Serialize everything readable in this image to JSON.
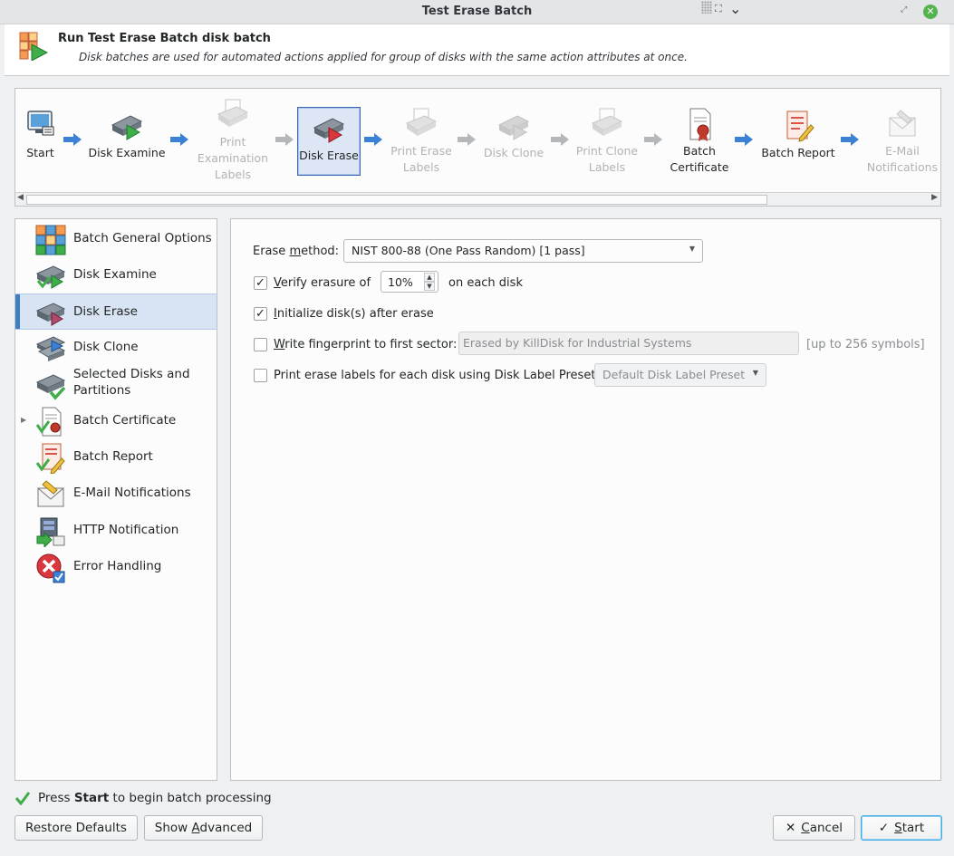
{
  "window": {
    "title": "Test Erase Batch"
  },
  "header": {
    "title": "Run Test Erase Batch disk batch",
    "subtitle": "Disk batches are used for automated actions applied for group of disks with the same action attributes at once."
  },
  "wizard_steps": [
    {
      "label": "Start",
      "icon": "computer-settings-icon",
      "state": "enabled"
    },
    {
      "label": "Disk Examine",
      "icon": "disk-play-icon",
      "state": "enabled"
    },
    {
      "label": "Print Examination Labels",
      "icon": "printer-icon",
      "state": "disabled"
    },
    {
      "label": "Disk Erase",
      "icon": "disk-erase-icon",
      "state": "current"
    },
    {
      "label": "Print Erase Labels",
      "icon": "printer-icon",
      "state": "disabled"
    },
    {
      "label": "Disk Clone",
      "icon": "disk-clone-icon",
      "state": "disabled"
    },
    {
      "label": "Print Clone Labels",
      "icon": "printer-icon",
      "state": "disabled"
    },
    {
      "label": "Batch Certificate",
      "icon": "certificate-icon",
      "state": "enabled"
    },
    {
      "label": "Batch Report",
      "icon": "report-icon",
      "state": "enabled"
    },
    {
      "label": "E-Mail Notifications",
      "icon": "email-icon",
      "state": "disabled"
    }
  ],
  "sidebar": {
    "items": [
      {
        "label": "Batch General Options",
        "icon": "grid-options-icon"
      },
      {
        "label": "Disk Examine",
        "icon": "disk-examine-icon"
      },
      {
        "label": "Disk Erase",
        "icon": "disk-erase-icon",
        "selected": true
      },
      {
        "label": "Disk Clone",
        "icon": "disk-clone-icon"
      },
      {
        "label": "Selected Disks and Partitions",
        "icon": "disk-check-icon"
      },
      {
        "label": "Batch Certificate",
        "icon": "certificate-icon"
      },
      {
        "label": "Batch Report",
        "icon": "report-icon"
      },
      {
        "label": "E-Mail Notifications",
        "icon": "email-icon"
      },
      {
        "label": "HTTP Notification",
        "icon": "http-icon"
      },
      {
        "label": "Error Handling",
        "icon": "error-icon"
      }
    ]
  },
  "form": {
    "erase_method": {
      "label_pre": "Erase ",
      "label_u": "m",
      "label_post": "ethod:",
      "value": "NIST 800-88 (One Pass Random) [1 pass]"
    },
    "verify": {
      "checked": true,
      "label_u": "V",
      "label_post": "erify erasure of",
      "value": "10%",
      "suffix": "on each disk"
    },
    "initialize": {
      "checked": true,
      "label_u": "I",
      "label_post": "nitialize disk(s) after erase"
    },
    "fingerprint": {
      "checked": false,
      "label_u": "W",
      "label_post": "rite fingerprint to first sector:",
      "placeholder": "Erased by KillDisk for Industrial Systems",
      "hint": "[up to 256 symbols]"
    },
    "print_labels": {
      "checked": false,
      "label": "Print erase labels for each disk using Disk Label Preset:",
      "preset": "Default Disk Label Preset"
    }
  },
  "status": {
    "pre": "Press ",
    "bold": "Start",
    "post": " to begin batch processing"
  },
  "buttons": {
    "restore": "Restore Defaults",
    "advanced_pre": "Show ",
    "advanced_u": "A",
    "advanced_post": "dvanced",
    "cancel_u": "C",
    "cancel_post": "ancel",
    "start_u": "S",
    "start_post": "tart"
  },
  "colors": {
    "accent": "#3daee9",
    "selection": "#d8e4f3",
    "success": "#53b34e"
  }
}
